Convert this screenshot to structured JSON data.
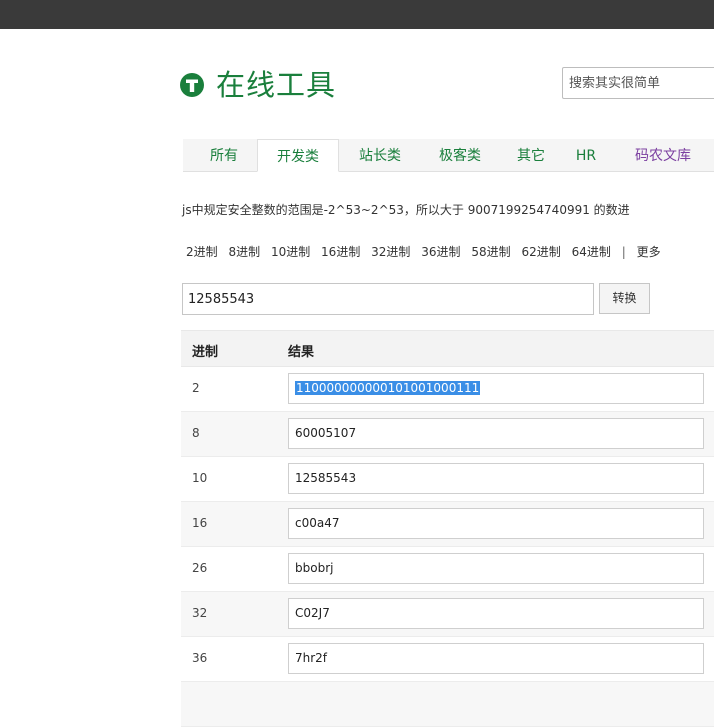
{
  "site": {
    "title": "在线工具"
  },
  "search": {
    "placeholder": "搜索其实很简单"
  },
  "nav": {
    "tabs": [
      "所有",
      "开发类",
      "站长类",
      "极客类",
      "其它",
      "HR",
      "码农文库"
    ]
  },
  "description": "js中规定安全整数的范围是-2^53~2^53，所以大于 9007199254740991 的数进",
  "base_links": [
    "2进制",
    "8进制",
    "10进制",
    "16进制",
    "32进制",
    "36进制",
    "58进制",
    "62进制",
    "64进制"
  ],
  "base_links_sep": "|",
  "base_links_more": "更多",
  "converter": {
    "value": "12585543",
    "button_label": "转换"
  },
  "table": {
    "headers": [
      "进制",
      "结果"
    ],
    "rows": [
      {
        "base": "2",
        "result": "110000000000101001000111"
      },
      {
        "base": "8",
        "result": "60005107"
      },
      {
        "base": "10",
        "result": "12585543"
      },
      {
        "base": "16",
        "result": "c00a47"
      },
      {
        "base": "26",
        "result": "bbobrj"
      },
      {
        "base": "32",
        "result": "C02J7"
      },
      {
        "base": "36",
        "result": "7hr2f"
      }
    ]
  },
  "colors": {
    "brand_green": "#1a7f3c",
    "topbar": "#3a3a3a",
    "selection": "#3a8ee6",
    "purple_link": "#7b3fa0"
  }
}
